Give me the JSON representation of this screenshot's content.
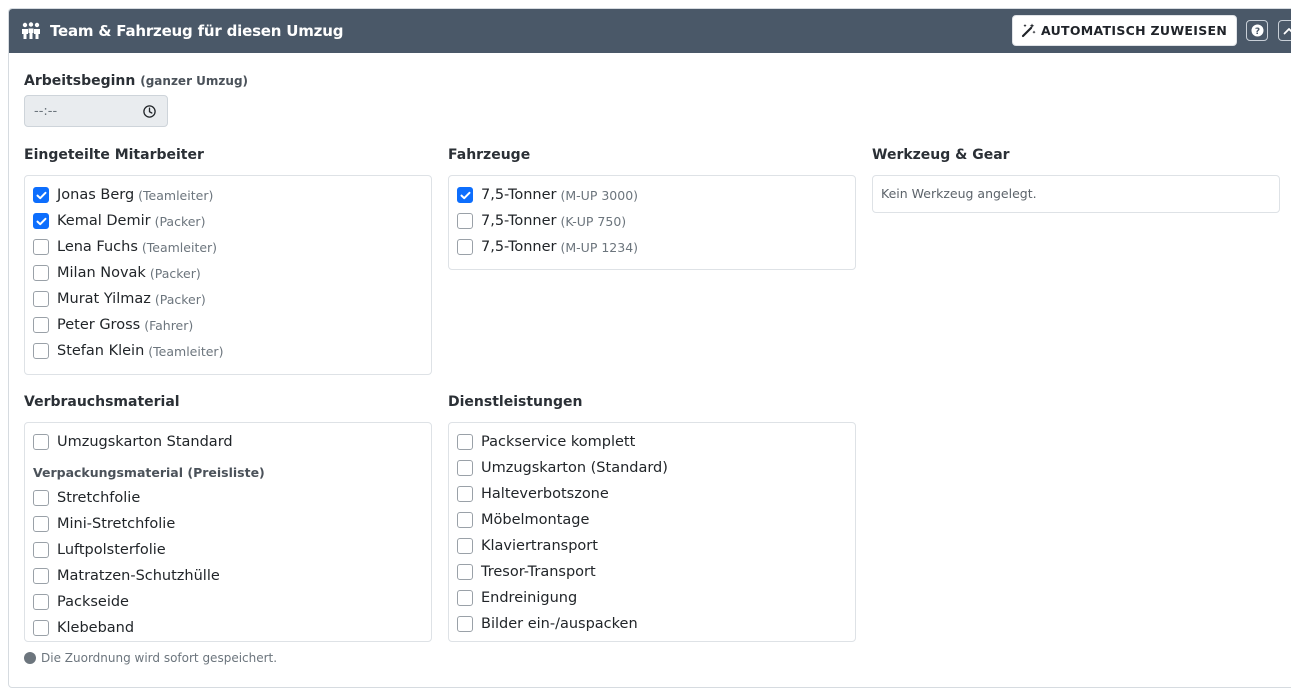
{
  "header": {
    "icon": "team-icon",
    "title": "Team & Fahrzeug für diesen Umzug",
    "auto_assign_label": "AUTOMATISCH ZUWEISEN",
    "auto_assign_icon": "magic-wand-icon",
    "help_icon": "question-circle-icon",
    "collapse_icon": "chevron-up-icon"
  },
  "start": {
    "label": "Arbeitsbeginn",
    "hint": "(ganzer Umzug)",
    "value": "--:--",
    "icon": "clock-icon"
  },
  "staff": {
    "title": "Eingeteilte Mitarbeiter",
    "items": [
      {
        "name": "Jonas Berg",
        "role": "(Teamleiter)",
        "checked": true
      },
      {
        "name": "Kemal Demir",
        "role": "(Packer)",
        "checked": true
      },
      {
        "name": "Lena Fuchs",
        "role": "(Teamleiter)",
        "checked": false
      },
      {
        "name": "Milan Novak",
        "role": "(Packer)",
        "checked": false
      },
      {
        "name": "Murat Yilmaz",
        "role": "(Packer)",
        "checked": false
      },
      {
        "name": "Peter Gross",
        "role": "(Fahrer)",
        "checked": false
      },
      {
        "name": "Stefan Klein",
        "role": "(Teamleiter)",
        "checked": false
      }
    ]
  },
  "vehicles": {
    "title": "Fahrzeuge",
    "items": [
      {
        "name": "7,5-Tonner",
        "plate": "(M-UP 3000)",
        "checked": true
      },
      {
        "name": "7,5-Tonner",
        "plate": "(K-UP 750)",
        "checked": false
      },
      {
        "name": "7,5-Tonner",
        "plate": "(M-UP 1234)",
        "checked": false
      }
    ]
  },
  "tools": {
    "title": "Werkzeug & Gear",
    "empty": "Kein Werkzeug angelegt."
  },
  "consumables": {
    "title": "Verbrauchsmaterial",
    "top_item": {
      "name": "Umzugskarton Standard",
      "checked": false
    },
    "group_label": "Verpackungsmaterial (Preisliste)",
    "items": [
      {
        "name": "Stretchfolie",
        "checked": false
      },
      {
        "name": "Mini-Stretchfolie",
        "checked": false
      },
      {
        "name": "Luftpolsterfolie",
        "checked": false
      },
      {
        "name": "Matratzen-Schutzhülle",
        "checked": false
      },
      {
        "name": "Packseide",
        "checked": false
      },
      {
        "name": "Klebeband",
        "checked": false
      }
    ]
  },
  "services": {
    "title": "Dienstleistungen",
    "items": [
      {
        "name": "Packservice komplett",
        "checked": false
      },
      {
        "name": "Umzugskarton (Standard)",
        "checked": false
      },
      {
        "name": "Halteverbotszone",
        "checked": false
      },
      {
        "name": "Möbelmontage",
        "checked": false
      },
      {
        "name": "Klaviertransport",
        "checked": false
      },
      {
        "name": "Tresor-Transport",
        "checked": false
      },
      {
        "name": "Endreinigung",
        "checked": false
      },
      {
        "name": "Bilder ein-/auspacken",
        "checked": false
      }
    ]
  },
  "footer": {
    "icon": "info-circle-icon",
    "note": "Die Zuordnung wird sofort gespeichert."
  },
  "colors": {
    "header_bg": "#4a5868",
    "checkbox_checked": "#0d6efd"
  }
}
